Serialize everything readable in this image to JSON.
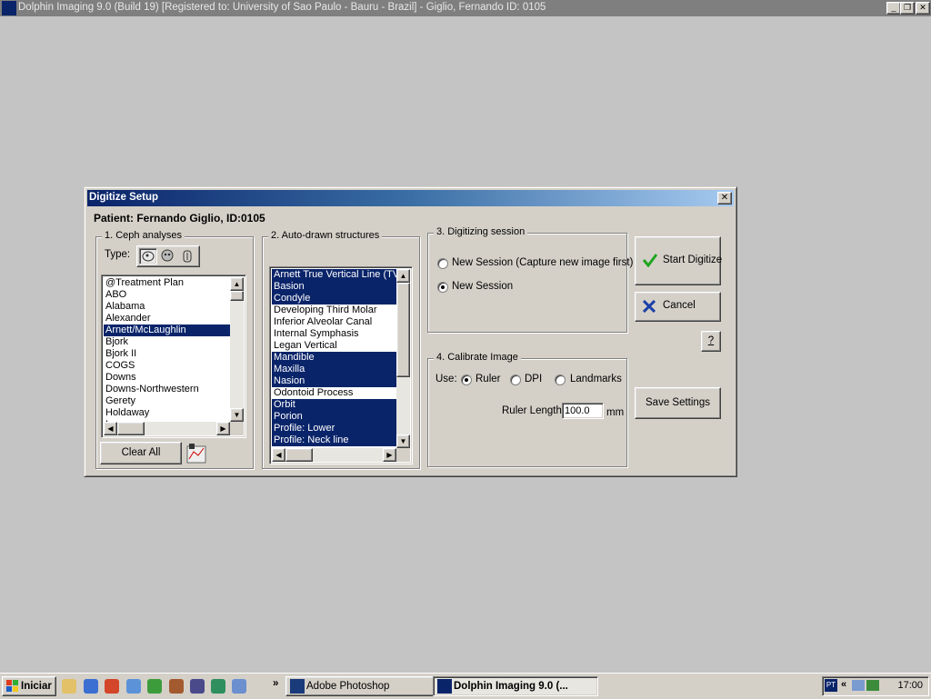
{
  "app": {
    "title": "Dolphin Imaging 9.0 (Build 19) [Registered to: University of Sao Paulo - Bauru - Brazil] - Giglio, Fernando  ID: 0105",
    "minimize": "_",
    "restore": "❐",
    "close": "✕"
  },
  "dialog": {
    "title": "Digitize Setup",
    "close": "✕",
    "patient": "Patient: Fernando Giglio, ID:0105",
    "ceph": {
      "legend": "1. Ceph analyses",
      "type_label": "Type:",
      "items": [
        "@Treatment Plan",
        "ABO",
        "Alabama",
        "Alexander",
        "Arnett/McLaughlin",
        "Bjork",
        "Bjork II",
        "COGS",
        "Downs",
        "Downs-Northwestern",
        "Gerety",
        "Holdaway",
        "Iowa"
      ],
      "selected_index": 4,
      "clear_all": "Clear All"
    },
    "structures": {
      "legend": "2. Auto-drawn structures",
      "items": [
        {
          "label": "Arnett True Vertical Line (TVL)",
          "selected": true
        },
        {
          "label": "Basion",
          "selected": true
        },
        {
          "label": "Condyle",
          "selected": true
        },
        {
          "label": "Developing Third Molar",
          "selected": false
        },
        {
          "label": "Inferior Alveolar Canal",
          "selected": false
        },
        {
          "label": "Internal Symphasis",
          "selected": false
        },
        {
          "label": "Legan Vertical",
          "selected": false
        },
        {
          "label": "Mandible",
          "selected": true
        },
        {
          "label": "Maxilla",
          "selected": true
        },
        {
          "label": "Nasion",
          "selected": true
        },
        {
          "label": "Odontoid Process",
          "selected": false
        },
        {
          "label": "Orbit",
          "selected": true
        },
        {
          "label": "Porion",
          "selected": true
        },
        {
          "label": "Profile: Lower",
          "selected": true
        },
        {
          "label": "Profile: Neck line",
          "selected": true
        }
      ]
    },
    "session": {
      "legend": "3. Digitizing session",
      "option1": "New Session (Capture new image first)",
      "option2": "New Session",
      "selected": "option2"
    },
    "calibrate": {
      "legend": "4. Calibrate Image",
      "use_label": "Use:",
      "opt_ruler": "Ruler",
      "opt_dpi": "DPI",
      "opt_landmarks": "Landmarks",
      "selected": "ruler",
      "ruler_length_label": "Ruler Length",
      "ruler_length_value": "100.0",
      "unit": "mm"
    },
    "buttons": {
      "start_digitize": "Start Digitize",
      "cancel": "Cancel",
      "help": "?",
      "save_settings": "Save Settings"
    }
  },
  "taskbar": {
    "start": "Iniciar",
    "chevron": "»",
    "tasks": [
      {
        "label": "Adobe Photoshop",
        "active": false
      },
      {
        "label": "Dolphin Imaging 9.0 (...",
        "active": true
      }
    ],
    "language": "PT",
    "tray_chevron": "«",
    "clock": "17:00"
  },
  "colors": {
    "selection": "#0a246a",
    "desktop": "#c4c4c4",
    "check_green": "#1fa51f",
    "cancel_blue": "#1c3fa8"
  }
}
